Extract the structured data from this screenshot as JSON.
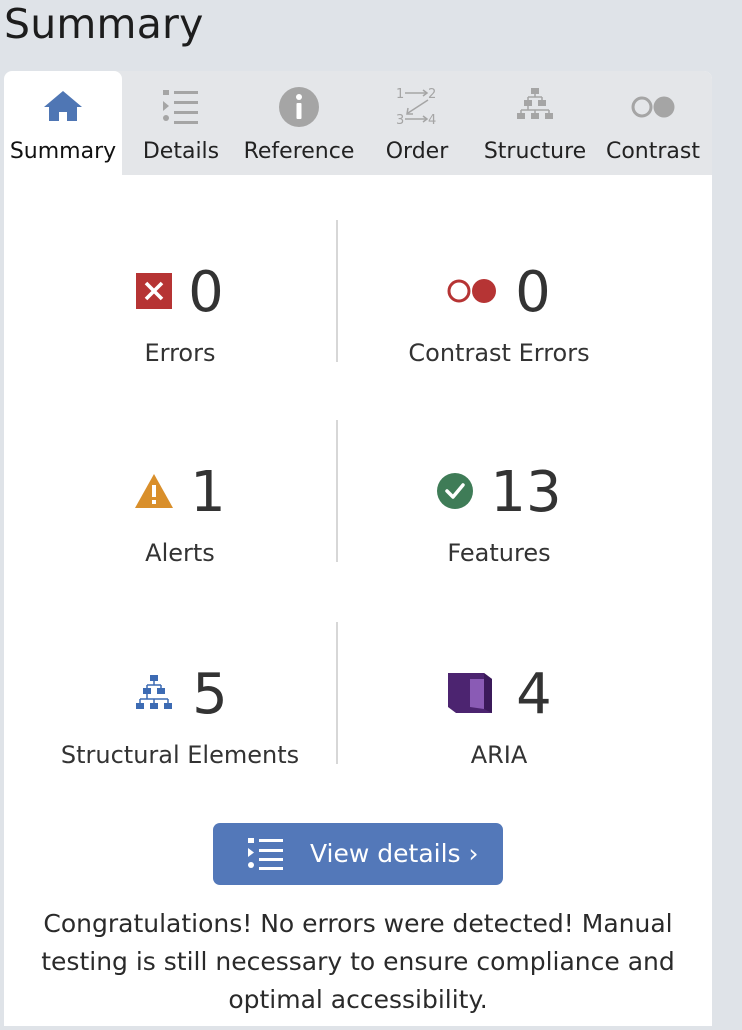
{
  "title": "Summary",
  "tabs": [
    {
      "label": "Summary",
      "icon": "home-icon",
      "active": true
    },
    {
      "label": "Details",
      "icon": "list-icon",
      "active": false
    },
    {
      "label": "Reference",
      "icon": "info-icon",
      "active": false
    },
    {
      "label": "Order",
      "icon": "order-icon",
      "active": false,
      "icon_text": [
        "1",
        "2",
        "3",
        "4"
      ]
    },
    {
      "label": "Structure",
      "icon": "structure-icon",
      "active": false
    },
    {
      "label": "Contrast",
      "icon": "contrast-icon",
      "active": false
    }
  ],
  "stats": {
    "errors": {
      "count": "0",
      "label": "Errors",
      "icon": "error-x-icon",
      "color": "#b63434"
    },
    "contrast_errors": {
      "count": "0",
      "label": "Contrast Errors",
      "icon": "contrast-error-icon",
      "color": "#b63434"
    },
    "alerts": {
      "count": "1",
      "label": "Alerts",
      "icon": "alert-triangle-icon",
      "color": "#d98f2b"
    },
    "features": {
      "count": "13",
      "label": "Features",
      "icon": "feature-check-icon",
      "color": "#3f7c57"
    },
    "structural": {
      "count": "5",
      "label": "Structural Elements",
      "icon": "structure-icon",
      "color": "#3d6bb3"
    },
    "aria": {
      "count": "4",
      "label": "ARIA",
      "icon": "aria-icon",
      "color": "#5b2d82"
    }
  },
  "view_details": {
    "label": "View details ›",
    "icon": "list-icon"
  },
  "message": "Congratulations! No errors were detected! Manual testing is still necessary to ensure compliance and optimal accessibility.",
  "colors": {
    "accent": "#5378b9",
    "tab_icon_inactive": "#a5a5a5",
    "background": "#dfe3e8"
  }
}
